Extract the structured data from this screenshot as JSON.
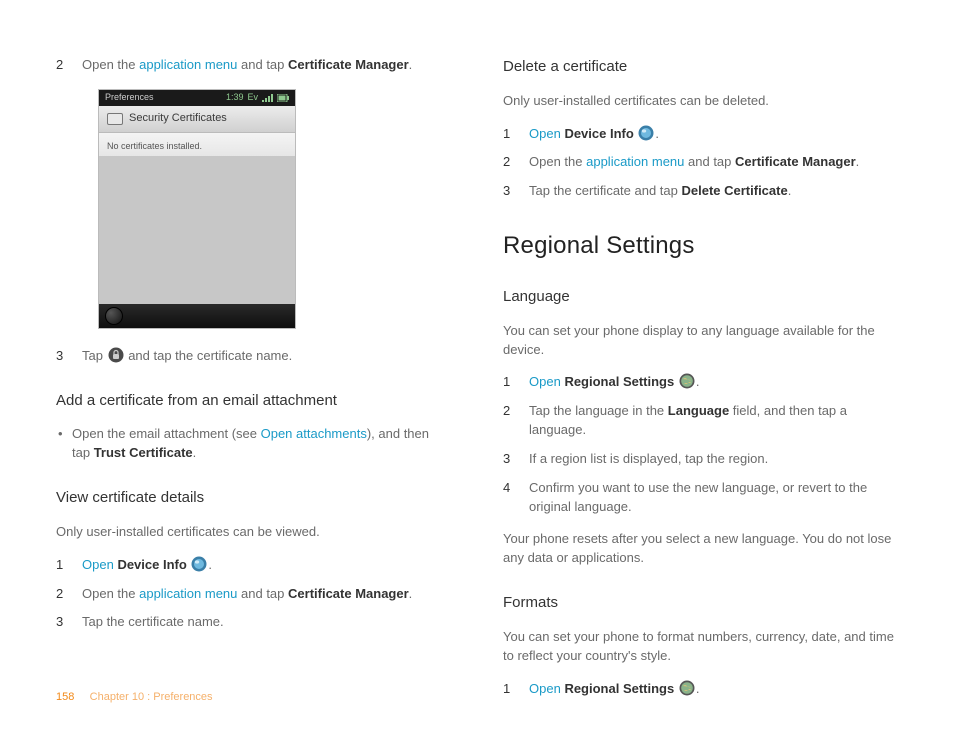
{
  "left": {
    "step2": {
      "pre": "Open the ",
      "link": "application menu",
      "mid": " and tap ",
      "bold": "Certificate Manager",
      "post": "."
    },
    "phone": {
      "status_left": "Preferences",
      "status_time": "1:39",
      "status_net": "Ev",
      "appbar_title": "Security Certificates",
      "notice": "No certificates installed."
    },
    "step3": {
      "pre": "Tap ",
      "post": " and tap the certificate name."
    },
    "add_cert_heading": "Add a certificate from an email attachment",
    "add_cert_bullet": {
      "pre": "Open the email attachment (see ",
      "link": "Open attachments",
      "mid": "), and then tap ",
      "bold": "Trust Certificate",
      "post": "."
    },
    "view_cert_heading": "View certificate details",
    "view_cert_intro": "Only user-installed certificates can be viewed.",
    "view_steps": {
      "s1": {
        "link": "Open",
        "bold": "Device Info",
        "post": "."
      },
      "s2": {
        "pre": "Open the ",
        "link": "application menu",
        "mid": " and tap ",
        "bold": "Certificate Manager",
        "post": "."
      },
      "s3": "Tap the certificate name."
    }
  },
  "right": {
    "delete_heading": "Delete a certificate",
    "delete_intro": "Only user-installed certificates can be deleted.",
    "delete_steps": {
      "s1": {
        "link": "Open",
        "bold": "Device Info",
        "post": "."
      },
      "s2": {
        "pre": "Open the ",
        "link": "application menu",
        "mid": " and tap ",
        "bold": "Certificate Manager",
        "post": "."
      },
      "s3": {
        "pre": "Tap the certificate and tap ",
        "bold": "Delete Certificate",
        "post": "."
      }
    },
    "regional_heading": "Regional Settings",
    "lang_heading": "Language",
    "lang_intro": "You can set your phone display to any language available for the device.",
    "lang_steps": {
      "s1": {
        "link": "Open",
        "bold": "Regional Settings",
        "post": "."
      },
      "s2": {
        "pre": "Tap the language in the ",
        "bold": "Language",
        "post": " field, and then tap a language."
      },
      "s3": "If a region list is displayed, tap the region.",
      "s4": "Confirm you want to use the new language, or revert to the original language."
    },
    "lang_note": "Your phone resets after you select a new language. You do not lose any data or applications.",
    "formats_heading": "Formats",
    "formats_intro": "You can set your phone to format numbers, currency, date, and time to reflect your country's style.",
    "formats_steps": {
      "s1": {
        "link": "Open",
        "bold": "Regional Settings",
        "post": "."
      }
    }
  },
  "footer": {
    "page": "158",
    "crumb": "Chapter 10 : Preferences"
  }
}
